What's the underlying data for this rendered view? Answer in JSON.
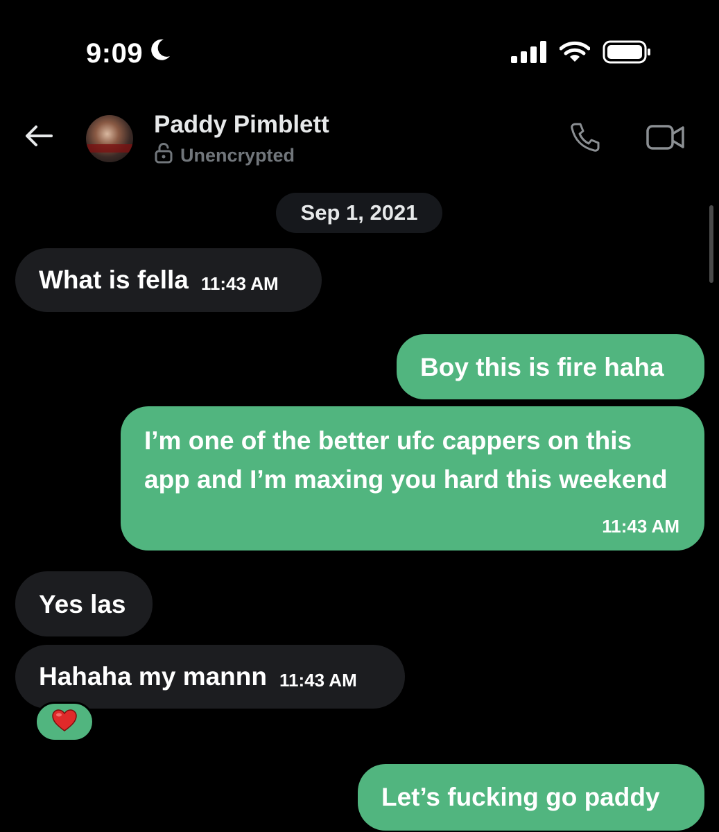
{
  "status_bar": {
    "time": "9:09",
    "icons": [
      "moon-icon",
      "cellular-signal-icon",
      "wifi-icon",
      "battery-icon"
    ]
  },
  "header": {
    "contact_name": "Paddy Pimblett",
    "encryption_status": "Unencrypted",
    "icons": [
      "back-arrow-icon",
      "lock-open-icon",
      "phone-icon",
      "video-camera-icon"
    ]
  },
  "conversation": {
    "date_separator": "Sep 1, 2021",
    "messages": [
      {
        "direction": "incoming",
        "text": "What is fella",
        "time": "11:43 AM"
      },
      {
        "direction": "outgoing",
        "text": "Boy this is fire haha",
        "time": ""
      },
      {
        "direction": "outgoing",
        "text": "I’m one of the better ufc cappers on this app and I’m maxing you hard this weekend",
        "time": "11:43 AM"
      },
      {
        "direction": "incoming",
        "text": "Yes las",
        "time": ""
      },
      {
        "direction": "incoming",
        "text": "Hahaha my mannn",
        "time": "11:43 AM",
        "reaction": "❤️"
      },
      {
        "direction": "outgoing",
        "text": "Let’s fucking go paddy",
        "time": ""
      }
    ]
  },
  "colors": {
    "background": "#000000",
    "incoming_bubble": "#1c1d20",
    "outgoing_bubble": "#51b57f",
    "secondary_text": "#71767b"
  }
}
